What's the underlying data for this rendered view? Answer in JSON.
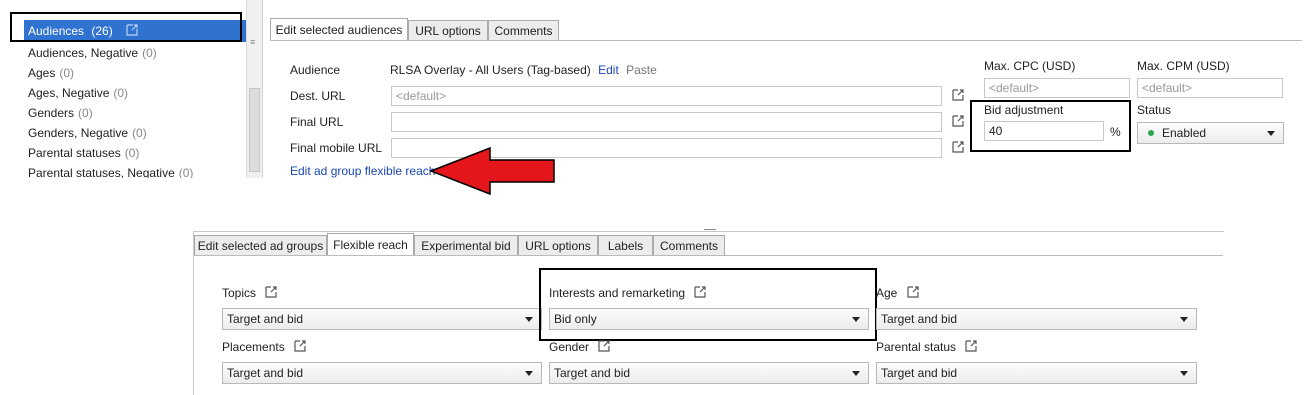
{
  "sidebar": {
    "items": [
      {
        "label": "Audiences",
        "count": "(26)"
      },
      {
        "label": "Audiences, Negative",
        "count": "(0)"
      },
      {
        "label": "Ages",
        "count": "(0)"
      },
      {
        "label": "Ages, Negative",
        "count": "(0)"
      },
      {
        "label": "Genders",
        "count": "(0)"
      },
      {
        "label": "Genders, Negative",
        "count": "(0)"
      },
      {
        "label": "Parental statuses",
        "count": "(0)"
      },
      {
        "label": "Parental statuses, Negative",
        "count": "(0)"
      }
    ]
  },
  "panel1": {
    "tabs": [
      "Edit selected audiences",
      "URL options",
      "Comments"
    ],
    "audience_label": "Audience",
    "audience_value": "RLSA Overlay - All Users (Tag-based)",
    "edit_link": "Edit",
    "paste_link": "Paste",
    "dest_url_label": "Dest. URL",
    "dest_url_placeholder": "<default>",
    "final_url_label": "Final URL",
    "final_mobile_url_label": "Final mobile URL",
    "flexible_reach_link": "Edit ad group flexible reach",
    "max_cpc_label": "Max. CPC (USD)",
    "max_cpc_placeholder": "<default>",
    "max_cpm_label": "Max. CPM (USD)",
    "max_cpm_placeholder": "<default>",
    "bid_adj_label": "Bid adjustment",
    "bid_adj_value": "40",
    "bid_adj_unit": "%",
    "status_label": "Status",
    "status_value": "Enabled",
    "status_color": "#2aa44f"
  },
  "panel2": {
    "tabs": [
      "Edit selected ad groups",
      "Flexible reach",
      "Experimental bid",
      "URL options",
      "Labels",
      "Comments"
    ],
    "topics_label": "Topics",
    "topics_value": "Target and bid",
    "interests_label": "Interests and remarketing",
    "interests_value": "Bid only",
    "age_label": "Age",
    "age_value": "Target and bid",
    "placements_label": "Placements",
    "placements_value": "Target and bid",
    "gender_label": "Gender",
    "gender_value": "Target and bid",
    "parental_label": "Parental status",
    "parental_value": "Target and bid"
  },
  "annotation_color": "#e4161b"
}
